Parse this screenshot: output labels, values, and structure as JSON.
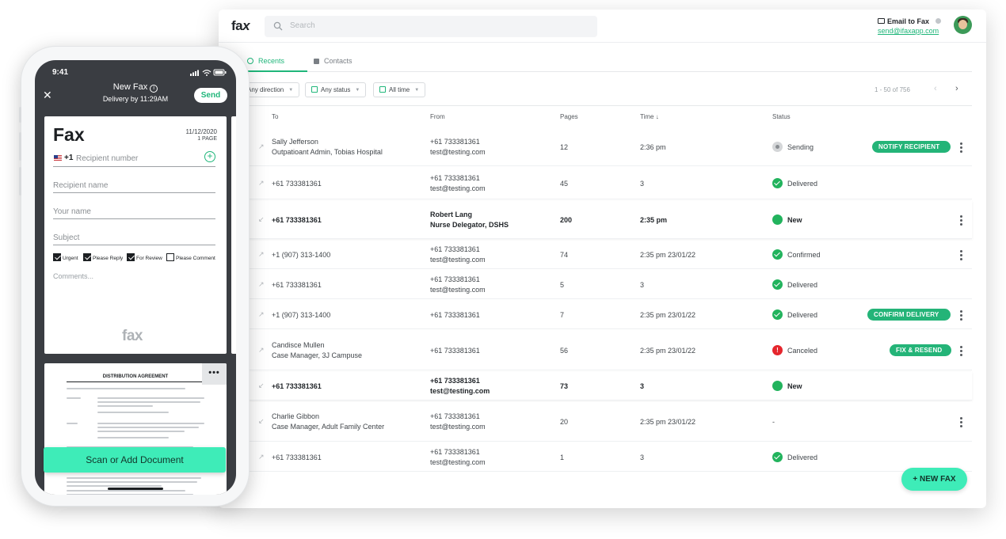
{
  "desktop": {
    "search_placeholder": "Search",
    "email_to_fax_label": "Email to Fax",
    "email_address": "send@ifaxapp.com",
    "tabs": [
      {
        "label": "Recents"
      },
      {
        "label": "Contacts"
      }
    ],
    "filters": [
      {
        "label": "Any direction"
      },
      {
        "label": "Any status"
      },
      {
        "label": "All time"
      }
    ],
    "pager": "1 - 50 of 756",
    "columns": {
      "to": "To",
      "from": "From",
      "pages": "Pages",
      "time": "Time ↓",
      "status": "Status"
    },
    "rows": [
      {
        "to": "Sally Jefferson",
        "to_sub": "Outpatioant Admin, Tobias Hospital",
        "from": "+61 733381361",
        "from_sub": "test@testing.com",
        "pages": "12",
        "time": "2:36 pm",
        "status": "Sending",
        "status_kind": "grey",
        "action": "NOTIFY RECIPIENT",
        "bold": false,
        "kebab": true
      },
      {
        "to": "+61 733381361",
        "to_sub": "",
        "from": "+61 733381361",
        "from_sub": "test@testing.com",
        "pages": "45",
        "time": "3",
        "status": "Delivered",
        "status_kind": "green-check",
        "action": "",
        "bold": false,
        "kebab": false
      },
      {
        "to": "+61 733381361",
        "to_sub": "",
        "from": "Robert Lang",
        "from_sub": "Nurse Delegator, DSHS",
        "pages": "200",
        "time": "2:35 pm",
        "status": "New",
        "status_kind": "green",
        "action": "",
        "bold": true,
        "kebab": true
      },
      {
        "to": "+1 (907) 313-1400",
        "to_sub": "",
        "from": "+61 733381361",
        "from_sub": "test@testing.com",
        "pages": "74",
        "time": "2:35 pm  23/01/22",
        "status": "Confirmed",
        "status_kind": "green-check",
        "action": "",
        "bold": false,
        "kebab": true
      },
      {
        "to": "+61 733381361",
        "to_sub": "",
        "from": "+61 733381361",
        "from_sub": "test@testing.com",
        "pages": "5",
        "time": "3",
        "status": "Delivered",
        "status_kind": "green-check",
        "action": "",
        "bold": false,
        "kebab": false
      },
      {
        "to": "+1 (907) 313-1400",
        "to_sub": "",
        "from": "+61 733381361",
        "from_sub": "",
        "pages": "7",
        "time": "2:35 pm  23/01/22",
        "status": "Delivered",
        "status_kind": "green-check",
        "action": "CONFIRM DELIVERY",
        "bold": false,
        "kebab": true
      },
      {
        "to": "Candisce Mullen",
        "to_sub": "Case Manager, 3J Campuse",
        "from": "+61 733381361",
        "from_sub": "",
        "pages": "56",
        "time": "2:35 pm 23/01/22",
        "status": "Canceled",
        "status_kind": "red",
        "action": "FIX & RESEND",
        "bold": false,
        "kebab": true
      },
      {
        "to": "+61 733381361",
        "to_sub": "",
        "from": "+61 733381361",
        "from_sub": "test@testing.com",
        "pages": "73",
        "time": "3",
        "status": "New",
        "status_kind": "green",
        "action": "",
        "bold": true,
        "kebab": false
      },
      {
        "to": "Charlie Gibbon",
        "to_sub": "Case Manager, Adult Family Center",
        "from": "+61 733381361",
        "from_sub": "test@testing.com",
        "pages": "20",
        "time": "2:35 pm  23/01/22",
        "status": "-",
        "status_kind": "none",
        "action": "",
        "bold": false,
        "kebab": true
      },
      {
        "to": "+61 733381361",
        "to_sub": "",
        "from": "+61 733381361",
        "from_sub": "test@testing.com",
        "pages": "1",
        "time": "3",
        "status": "Delivered",
        "status_kind": "green-check",
        "action": "",
        "bold": false,
        "kebab": false
      }
    ],
    "new_fax_label": "+ NEW FAX"
  },
  "phone": {
    "time": "9:41",
    "title": "New Fax",
    "subtitle": "Delivery by 11:29AM",
    "send_label": "Send",
    "fax_heading": "Fax",
    "date": "11/12/2020",
    "pages": "1 PAGE",
    "country_code": "+1",
    "recipient_number_placeholder": "Recipient number",
    "recipient_name_placeholder": "Recipient name",
    "your_name_placeholder": "Your name",
    "subject_placeholder": "Subject",
    "checkboxes": [
      {
        "label": "Urgent",
        "checked": true
      },
      {
        "label": "Please Reply",
        "checked": true
      },
      {
        "label": "For Review",
        "checked": true
      },
      {
        "label": "Please Comment",
        "checked": false
      }
    ],
    "comments_placeholder": "Comments...",
    "watermark": "fax",
    "doc_title": "DISTRIBUTION AGREEMENT",
    "scan_label": "Scan or Add Document"
  },
  "colors": {
    "accent": "#1fb67a",
    "new_fax_button": "#3eecb8",
    "canceled": "#e5262d",
    "delivered": "#22b35d"
  }
}
